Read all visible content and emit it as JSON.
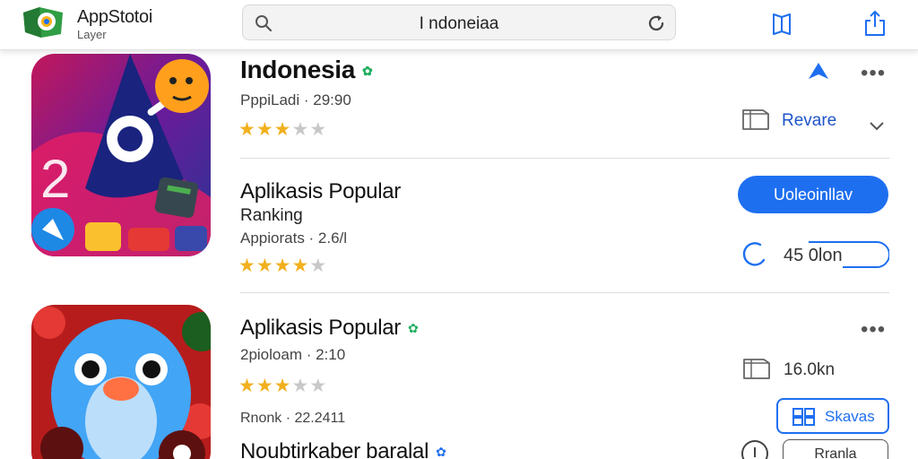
{
  "header": {
    "brand_name": "AppStotoi",
    "brand_sub": "Layer",
    "search_value": "I ndoneiaa",
    "colors": {
      "accent": "#1e6ff0",
      "star": "#f2b01e",
      "verified": "#1fae5e"
    },
    "icons": [
      "app-logo-icon",
      "search-icon",
      "refresh-icon",
      "bookmark-icon",
      "share-icon"
    ]
  },
  "rows": [
    {
      "title": "Indonesia",
      "meta": "PppiLadi · 29:90",
      "rating": 3,
      "side_label": "Revare",
      "icons": [
        "verified-icon",
        "up-arrow-icon",
        "more-icon",
        "box-icon",
        "chevron-down-icon"
      ]
    },
    {
      "title": "Aplikasis Popular",
      "sublabel": "Ranking",
      "meta": "Appiorats · 2.6/l",
      "rating": 4,
      "action_label": "Uoleoinllav",
      "size": "45 0lon",
      "icons": [
        "spinner-icon"
      ]
    },
    {
      "title": "Aplikasis Popular",
      "meta": "2pioloam · 2:10",
      "rating": 3,
      "size": "16.0kn",
      "date": "Rnonk · 22.2411",
      "button_label": "Skavas",
      "icons": [
        "verified-icon",
        "more-icon",
        "box-icon",
        "grid-icon"
      ]
    },
    {
      "title": "Noubtirkaber baralal",
      "button_label": "Rranla",
      "icons": [
        "verified-icon",
        "info-icon"
      ]
    }
  ]
}
